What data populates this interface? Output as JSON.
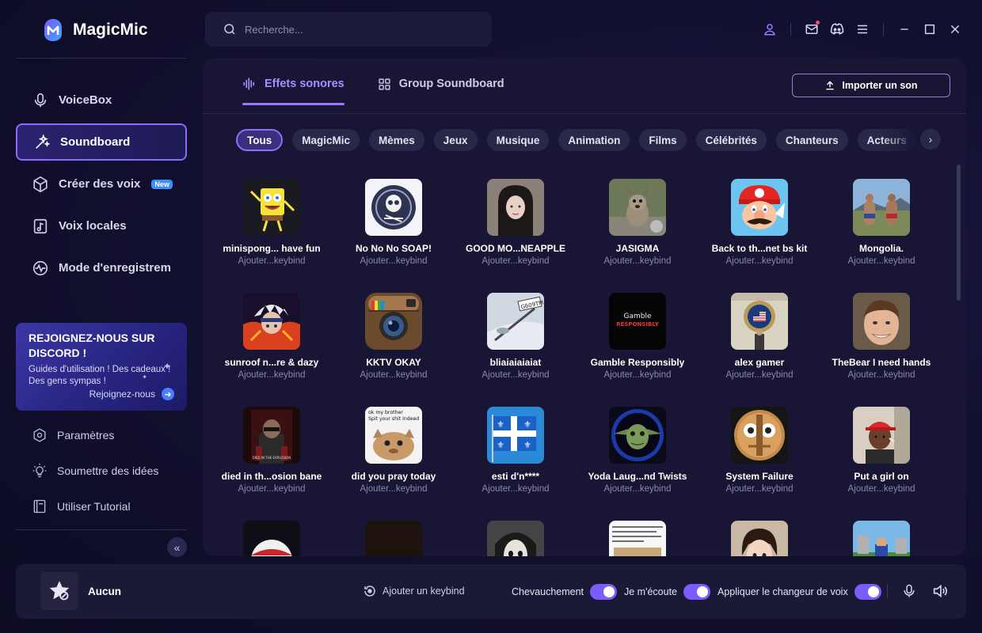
{
  "app": {
    "name": "MagicMic"
  },
  "search": {
    "placeholder": "Recherche..."
  },
  "sidebar": {
    "items": [
      {
        "label": "VoiceBox",
        "icon": "microphone-icon"
      },
      {
        "label": "Soundboard",
        "icon": "sparkle-wand-icon",
        "active": true
      },
      {
        "label": "Créer des voix",
        "icon": "cube-icon",
        "badge": "New"
      },
      {
        "label": "Voix locales",
        "icon": "music-file-icon"
      },
      {
        "label": "Mode d'enregistrem",
        "icon": "waveform-circle-icon"
      }
    ],
    "discord": {
      "title_line1": "REJOIGNEZ-NOUS SUR",
      "title_line2": "DISCORD !",
      "text_line1": "Guides d'utilisation ! Des cadeaux !",
      "text_line2": "Des gens sympas !",
      "link": "Rejoignez-nous"
    },
    "footer_items": [
      {
        "label": "Paramètres",
        "icon": "settings-icon"
      },
      {
        "label": "Soumettre des idées",
        "icon": "lightbulb-icon"
      },
      {
        "label": "Utiliser Tutorial",
        "icon": "book-icon"
      }
    ]
  },
  "tabs": [
    {
      "label": "Effets sonores",
      "icon": "waveform-icon",
      "active": true
    },
    {
      "label": "Group Soundboard",
      "icon": "grid-icon"
    }
  ],
  "import_label": "Importer un son",
  "categories": [
    "Tous",
    "MagicMic",
    "Mèmes",
    "Jeux",
    "Musique",
    "Animation",
    "Films",
    "Célébrités",
    "Chanteurs",
    "Acteurs"
  ],
  "sounds": [
    [
      {
        "title": "minispong... have fun",
        "sub": "Ajouter...keybind",
        "icon": "sponge-character-icon"
      },
      {
        "title": "No No No SOAP!",
        "sub": "Ajouter...keybind",
        "icon": "skull-emblem-icon"
      },
      {
        "title": "GOOD MO...NEAPPLE",
        "sub": "Ajouter...keybind",
        "icon": "girl-portrait-icon"
      },
      {
        "title": "JASIGMA",
        "sub": "Ajouter...keybind",
        "icon": "dog-photo-icon"
      },
      {
        "title": "Back to th...net bs kit",
        "sub": "Ajouter...keybind",
        "icon": "plumber-character-icon"
      },
      {
        "title": "Mongolia.",
        "sub": "Ajouter...keybind",
        "icon": "wrestlers-photo-icon"
      }
    ],
    [
      {
        "title": "sunroof n...re & dazy",
        "sub": "Ajouter...keybind",
        "icon": "anime-character-icon"
      },
      {
        "title": "KKTV OKAY",
        "sub": "Ajouter...keybind",
        "icon": "camera-app-icon"
      },
      {
        "title": "bliaiaiaiaiat",
        "sub": "Ajouter...keybind",
        "icon": "snow-sled-icon"
      },
      {
        "title": "Gamble Responsibly",
        "sub": "Ajouter...keybind",
        "icon": "gamble-text-icon",
        "thumb_line1": "Gamble",
        "thumb_line2": "RESPONSIBLY"
      },
      {
        "title": "alex gamer",
        "sub": "Ajouter...keybind",
        "icon": "flag-seal-icon"
      },
      {
        "title": "TheBear I need hands",
        "sub": "Ajouter...keybind",
        "icon": "man-face-icon"
      }
    ],
    [
      {
        "title": "died in th...osion bane",
        "sub": "Ajouter...keybind",
        "icon": "masked-figure-icon"
      },
      {
        "title": "did you pray today",
        "sub": "Ajouter...keybind",
        "icon": "cat-meme-icon",
        "thumb_line1": "ok my brother",
        "thumb_line2": "Spit your shit indeed"
      },
      {
        "title": "esti d'n****",
        "sub": "Ajouter...keybind",
        "icon": "quebec-flag-icon"
      },
      {
        "title": "Yoda Laug...nd Twists",
        "sub": "Ajouter...keybind",
        "icon": "yoda-icon"
      },
      {
        "title": "System Failure",
        "sub": "Ajouter...keybind",
        "icon": "robot-face-icon"
      },
      {
        "title": "Put a girl on",
        "sub": "Ajouter...keybind",
        "icon": "man-red-cap-icon"
      }
    ],
    [
      {
        "title": "",
        "sub": "",
        "icon": "cartoon-face-icon"
      },
      {
        "title": "",
        "sub": "",
        "icon": "dark-thumb-icon"
      },
      {
        "title": "",
        "sub": "",
        "icon": "pale-face-icon"
      },
      {
        "title": "",
        "sub": "",
        "icon": "text-meme-icon"
      },
      {
        "title": "",
        "sub": "",
        "icon": "anime-boy-icon"
      },
      {
        "title": "",
        "sub": "",
        "icon": "pixel-game-icon"
      }
    ]
  ],
  "bottom": {
    "now_playing": "Aucun",
    "add_keybind": "Ajouter un keybind",
    "toggles": [
      {
        "label": "Chevauchement",
        "on": true
      },
      {
        "label": "Je m'écoute",
        "on": true
      },
      {
        "label": "Appliquer le changeur de voix",
        "on": true
      }
    ]
  },
  "colors": {
    "accent": "#8f6bff",
    "background": "#0e0d26",
    "panel": "#181634"
  }
}
